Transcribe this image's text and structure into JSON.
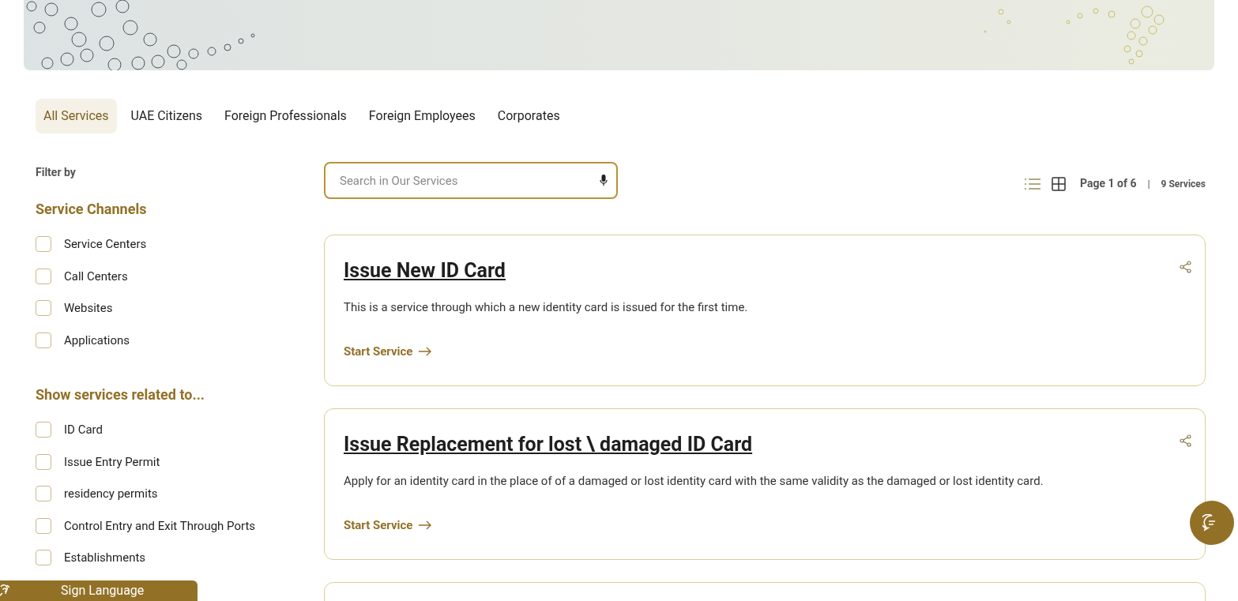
{
  "tabs": [
    {
      "label": "All Services",
      "selected": true
    },
    {
      "label": "UAE Citizens",
      "selected": false
    },
    {
      "label": "Foreign Professionals",
      "selected": false
    },
    {
      "label": "Foreign Employees",
      "selected": false
    },
    {
      "label": "Corporates",
      "selected": false
    }
  ],
  "filter": {
    "title": "Filter by",
    "groups": [
      {
        "heading": "Service Channels",
        "items": [
          {
            "label": "Service Centers",
            "checked": false
          },
          {
            "label": "Call Centers",
            "checked": false
          },
          {
            "label": "Websites",
            "checked": false
          },
          {
            "label": "Applications",
            "checked": false
          }
        ]
      },
      {
        "heading": "Show services related to...",
        "items": [
          {
            "label": "ID Card",
            "checked": false
          },
          {
            "label": "Issue Entry Permit",
            "checked": false
          },
          {
            "label": "residency permits",
            "checked": false
          },
          {
            "label": "Control Entry and Exit Through Ports",
            "checked": false
          },
          {
            "label": "Establishments",
            "checked": false
          }
        ]
      }
    ]
  },
  "search": {
    "placeholder": "Search in Our Services"
  },
  "pagination": {
    "page": "Page 1 of 6",
    "separator": "|",
    "count": "9 Services"
  },
  "services": [
    {
      "title": "Issue New ID Card",
      "description": "This is a service through which a new identity card is issued for the first time.",
      "action": "Start Service"
    },
    {
      "title": "Issue Replacement for lost \\ damaged ID Card",
      "description": "Apply for an identity card in the place of of a damaged or lost identity card with the same validity as the damaged or lost identity card.",
      "action": "Start Service"
    }
  ],
  "sign_language": {
    "label": "Sign Language"
  }
}
